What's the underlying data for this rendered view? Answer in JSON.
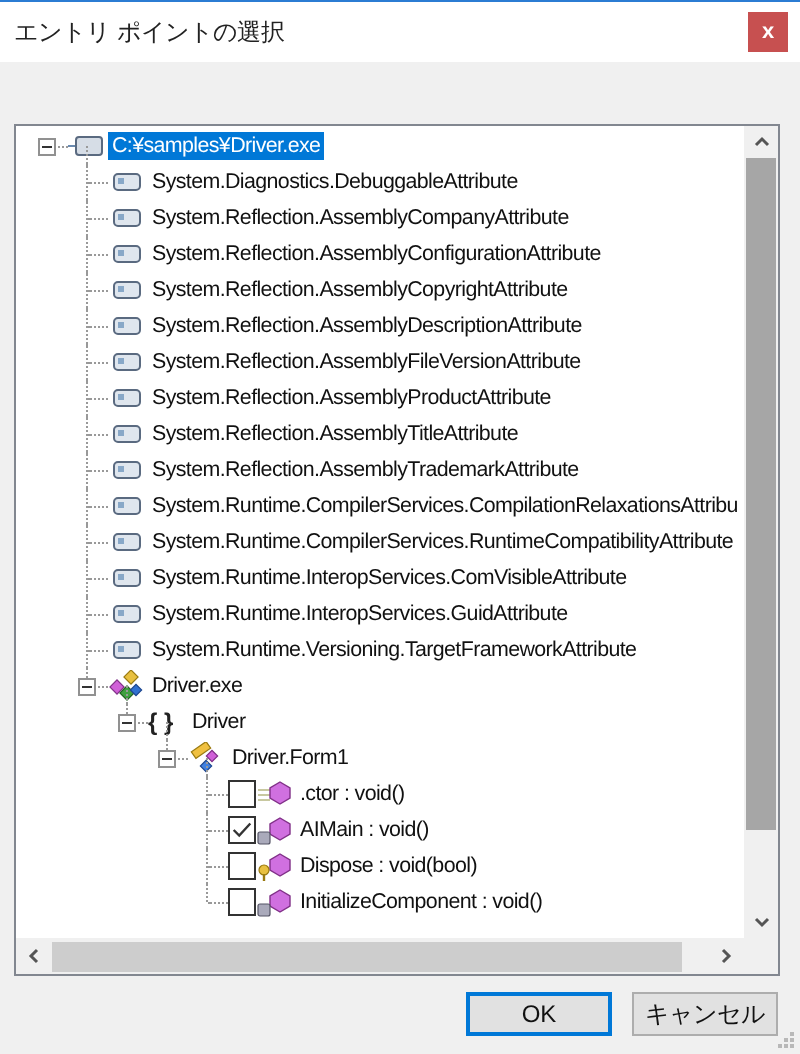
{
  "window": {
    "title": "エントリ ポイントの選択",
    "close": "x"
  },
  "tree": [
    {
      "label": "C:¥samples¥Driver.exe",
      "kind": "file",
      "selected": true,
      "expanded": true,
      "children": [
        {
          "label": "System.Diagnostics.DebuggableAttribute",
          "kind": "attr",
          "selected": false
        },
        {
          "label": "System.Reflection.AssemblyCompanyAttribute",
          "kind": "attr",
          "selected": false
        },
        {
          "label": "System.Reflection.AssemblyConfigurationAttribute",
          "kind": "attr",
          "selected": false
        },
        {
          "label": "System.Reflection.AssemblyCopyrightAttribute",
          "kind": "attr",
          "selected": false
        },
        {
          "label": "System.Reflection.AssemblyDescriptionAttribute",
          "kind": "attr",
          "selected": false
        },
        {
          "label": "System.Reflection.AssemblyFileVersionAttribute",
          "kind": "attr",
          "selected": false
        },
        {
          "label": "System.Reflection.AssemblyProductAttribute",
          "kind": "attr",
          "selected": false
        },
        {
          "label": "System.Reflection.AssemblyTitleAttribute",
          "kind": "attr",
          "selected": false
        },
        {
          "label": "System.Reflection.AssemblyTrademarkAttribute",
          "kind": "attr",
          "selected": false
        },
        {
          "label": "System.Runtime.CompilerServices.CompilationRelaxationsAttribu",
          "kind": "attr",
          "selected": false
        },
        {
          "label": "System.Runtime.CompilerServices.RuntimeCompatibilityAttribute",
          "kind": "attr",
          "selected": false
        },
        {
          "label": "System.Runtime.InteropServices.ComVisibleAttribute",
          "kind": "attr",
          "selected": false
        },
        {
          "label": "System.Runtime.InteropServices.GuidAttribute",
          "kind": "attr",
          "selected": false
        },
        {
          "label": "System.Runtime.Versioning.TargetFrameworkAttribute",
          "kind": "attr",
          "selected": false
        },
        {
          "label": "Driver.exe",
          "kind": "assembly",
          "selected": false,
          "expanded": true,
          "children": [
            {
              "label": "Driver",
              "kind": "namespace",
              "glyph": "{ }",
              "selected": false,
              "expanded": true,
              "children": [
                {
                  "label": "Driver.Form1",
                  "kind": "class",
                  "selected": false,
                  "expanded": true,
                  "children": [
                    {
                      "label": ".ctor : void()",
                      "kind": "method",
                      "checked": false,
                      "selected": false
                    },
                    {
                      "label": "AIMain : void()",
                      "kind": "private",
                      "checked": true,
                      "selected": false
                    },
                    {
                      "label": "Dispose : void(bool)",
                      "kind": "protected",
                      "checked": false,
                      "selected": false
                    },
                    {
                      "label": "InitializeComponent : void()",
                      "kind": "private",
                      "checked": false,
                      "selected": false
                    }
                  ]
                }
              ]
            }
          ]
        }
      ]
    }
  ],
  "buttons": [
    {
      "label": "OK",
      "default": true
    },
    {
      "label": "キャンセル",
      "default": false
    }
  ]
}
